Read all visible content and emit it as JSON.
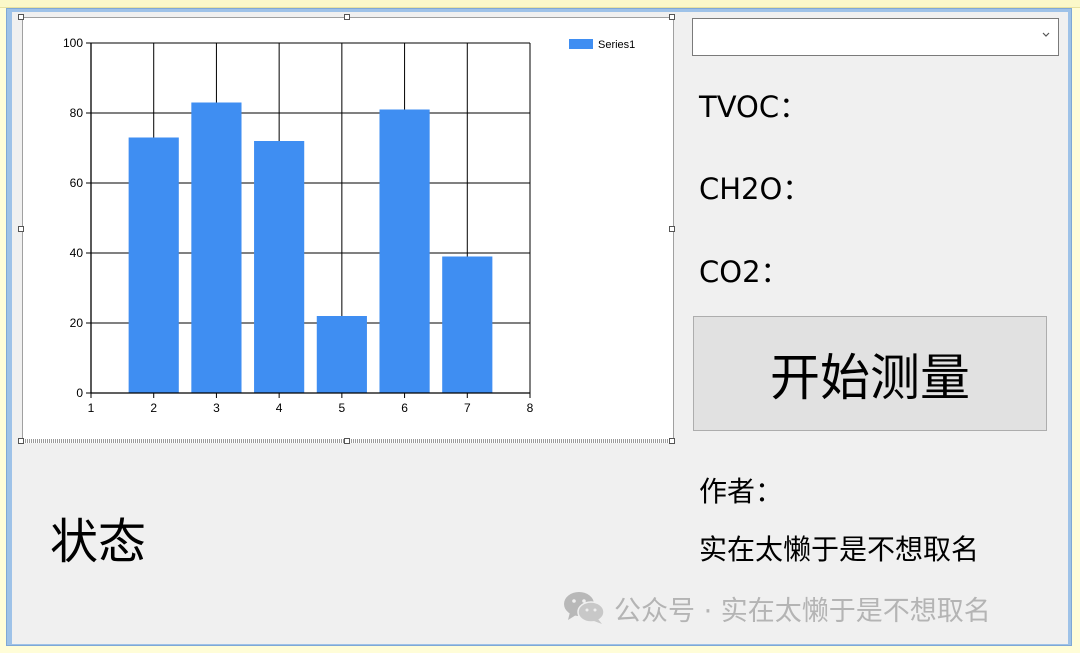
{
  "form": {
    "status_label": "状态",
    "start_button_label": "开始测量",
    "combo_value": "",
    "tvoc_label": "TVOC：",
    "ch2o_label": "CH2O：",
    "co2_label": "CO2：",
    "author_title": "作者：",
    "author_name": "实在太懒于是不想取名"
  },
  "watermark": {
    "icon": "wechat-icon",
    "text": "公众号 · 实在太懒于是不想取名"
  },
  "colors": {
    "bar": "#3f8ef2",
    "form_bg": "#f0f0f0",
    "watermark": "#b4b4b4"
  },
  "chart_data": {
    "type": "bar",
    "title": "",
    "xlabel": "",
    "ylabel": "",
    "x_ticks": [
      1,
      2,
      3,
      4,
      5,
      6,
      7,
      8
    ],
    "y_ticks": [
      0,
      20,
      40,
      60,
      80,
      100
    ],
    "xlim": [
      1,
      8
    ],
    "ylim": [
      0,
      100
    ],
    "grid": true,
    "legend": "top-right",
    "series": [
      {
        "name": "Series1",
        "x": [
          2,
          3,
          4,
          5,
          6,
          7
        ],
        "values": [
          73,
          83,
          72,
          22,
          81,
          39
        ]
      }
    ]
  }
}
